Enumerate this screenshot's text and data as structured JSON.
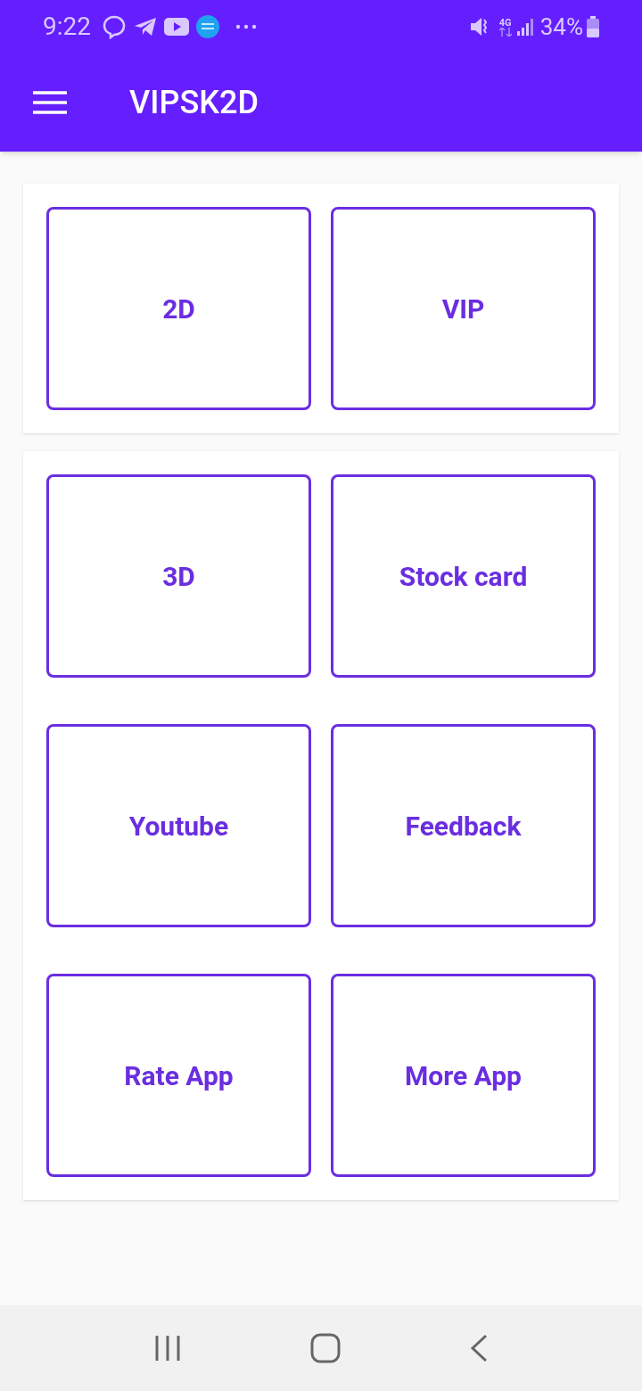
{
  "status_bar": {
    "time": "9:22",
    "network": "4G",
    "battery": "34%"
  },
  "app_bar": {
    "title": "VIPSK2D"
  },
  "sections": [
    {
      "buttons": [
        "2D",
        "VIP"
      ]
    },
    {
      "buttons": [
        "3D",
        "Stock card",
        "Youtube",
        "Feedback",
        "Rate App",
        "More App"
      ]
    }
  ]
}
